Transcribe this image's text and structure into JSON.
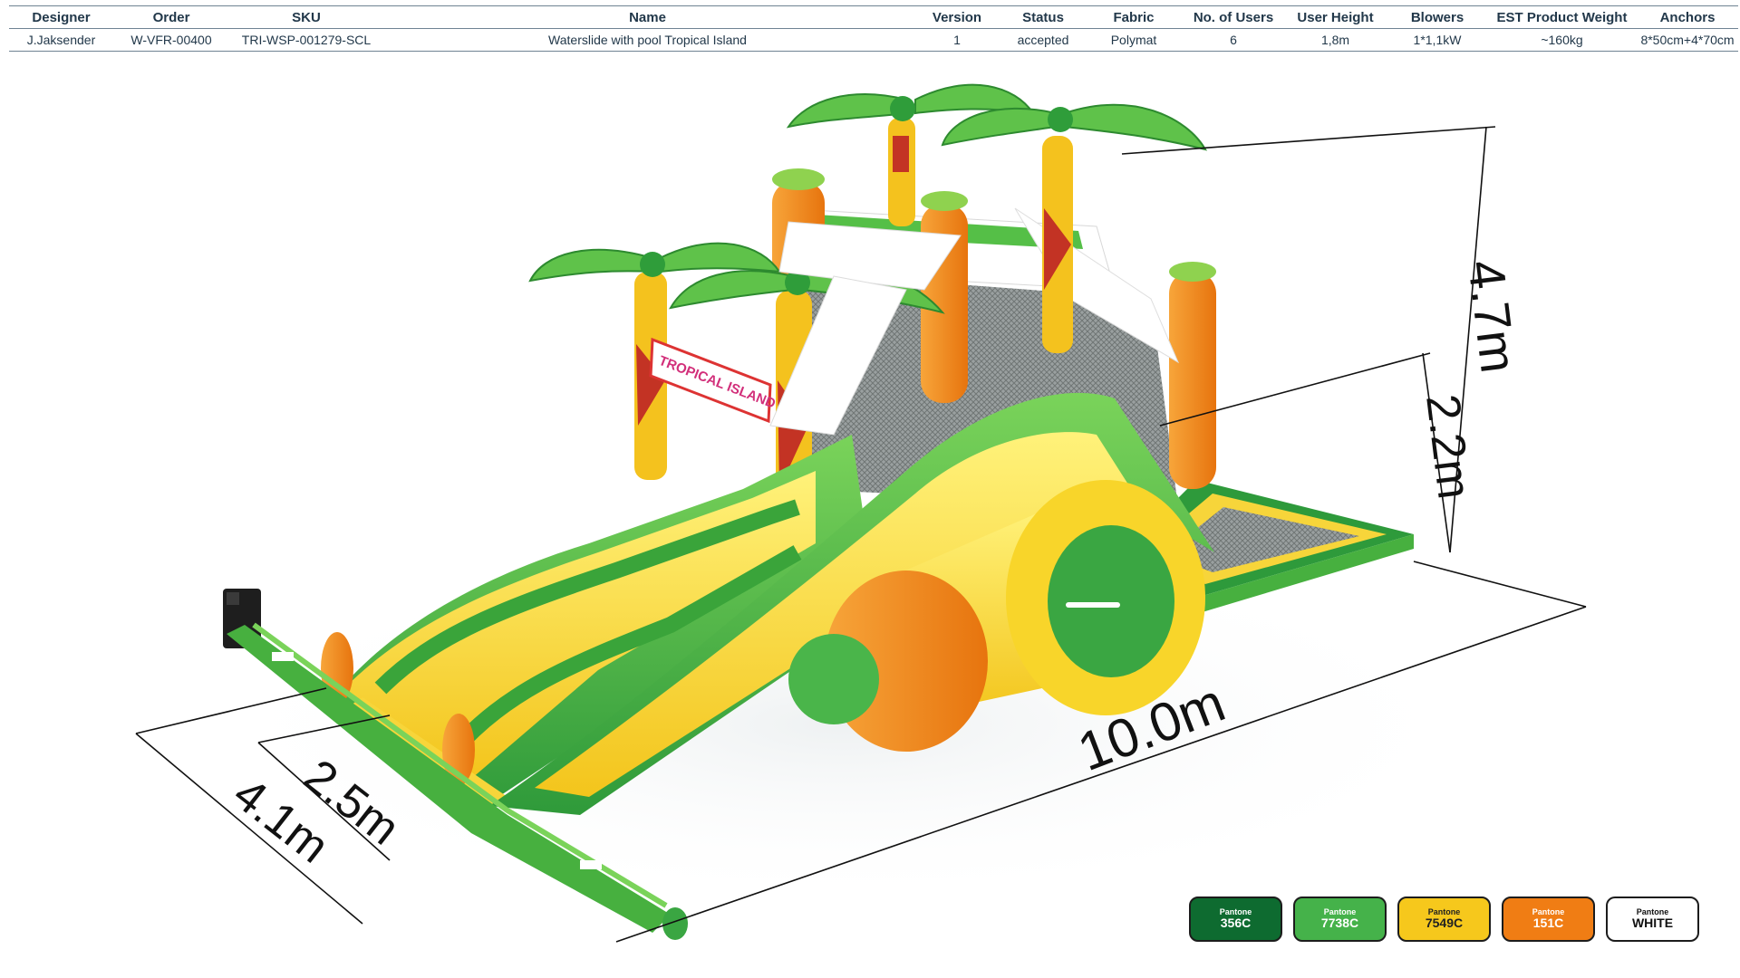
{
  "spec_table": {
    "headers": [
      "Designer",
      "Order",
      "SKU",
      "Name",
      "Version",
      "Status",
      "Fabric",
      "No. of Users",
      "User  Height",
      "Blowers",
      "EST Product Weight",
      "Anchors"
    ],
    "row": [
      "J.Jaksender",
      "W-VFR-00400",
      "TRI-WSP-001279-SCL",
      "Waterslide with pool Tropical Island",
      "1",
      "accepted",
      "Polymat",
      "6",
      "1,8m",
      "1*1,1kW",
      "~160kg",
      "8*50cm+4*70cm"
    ]
  },
  "render": {
    "sign_text": "TROPICAL ISLAND",
    "dimensions": {
      "height_total": "4.7m",
      "height_platform": "2.2m",
      "length": "10.0m",
      "width_total": "4.1m",
      "width_slide": "2.5m"
    }
  },
  "swatches": [
    {
      "brand": "Pantone",
      "code": "356C",
      "color": "#0e6b30",
      "text_color": "#ffffff"
    },
    {
      "brand": "Pantone",
      "code": "7738C",
      "color": "#45b24a",
      "text_color": "#ffffff"
    },
    {
      "brand": "Pantone",
      "code": "7549C",
      "color": "#f6c81c",
      "text_color": "#222222"
    },
    {
      "brand": "Pantone",
      "code": "151C",
      "color": "#f07d14",
      "text_color": "#ffffff"
    },
    {
      "brand": "Pantone",
      "code": "WHITE",
      "color": "#ffffff",
      "text_color": "#111111"
    }
  ]
}
